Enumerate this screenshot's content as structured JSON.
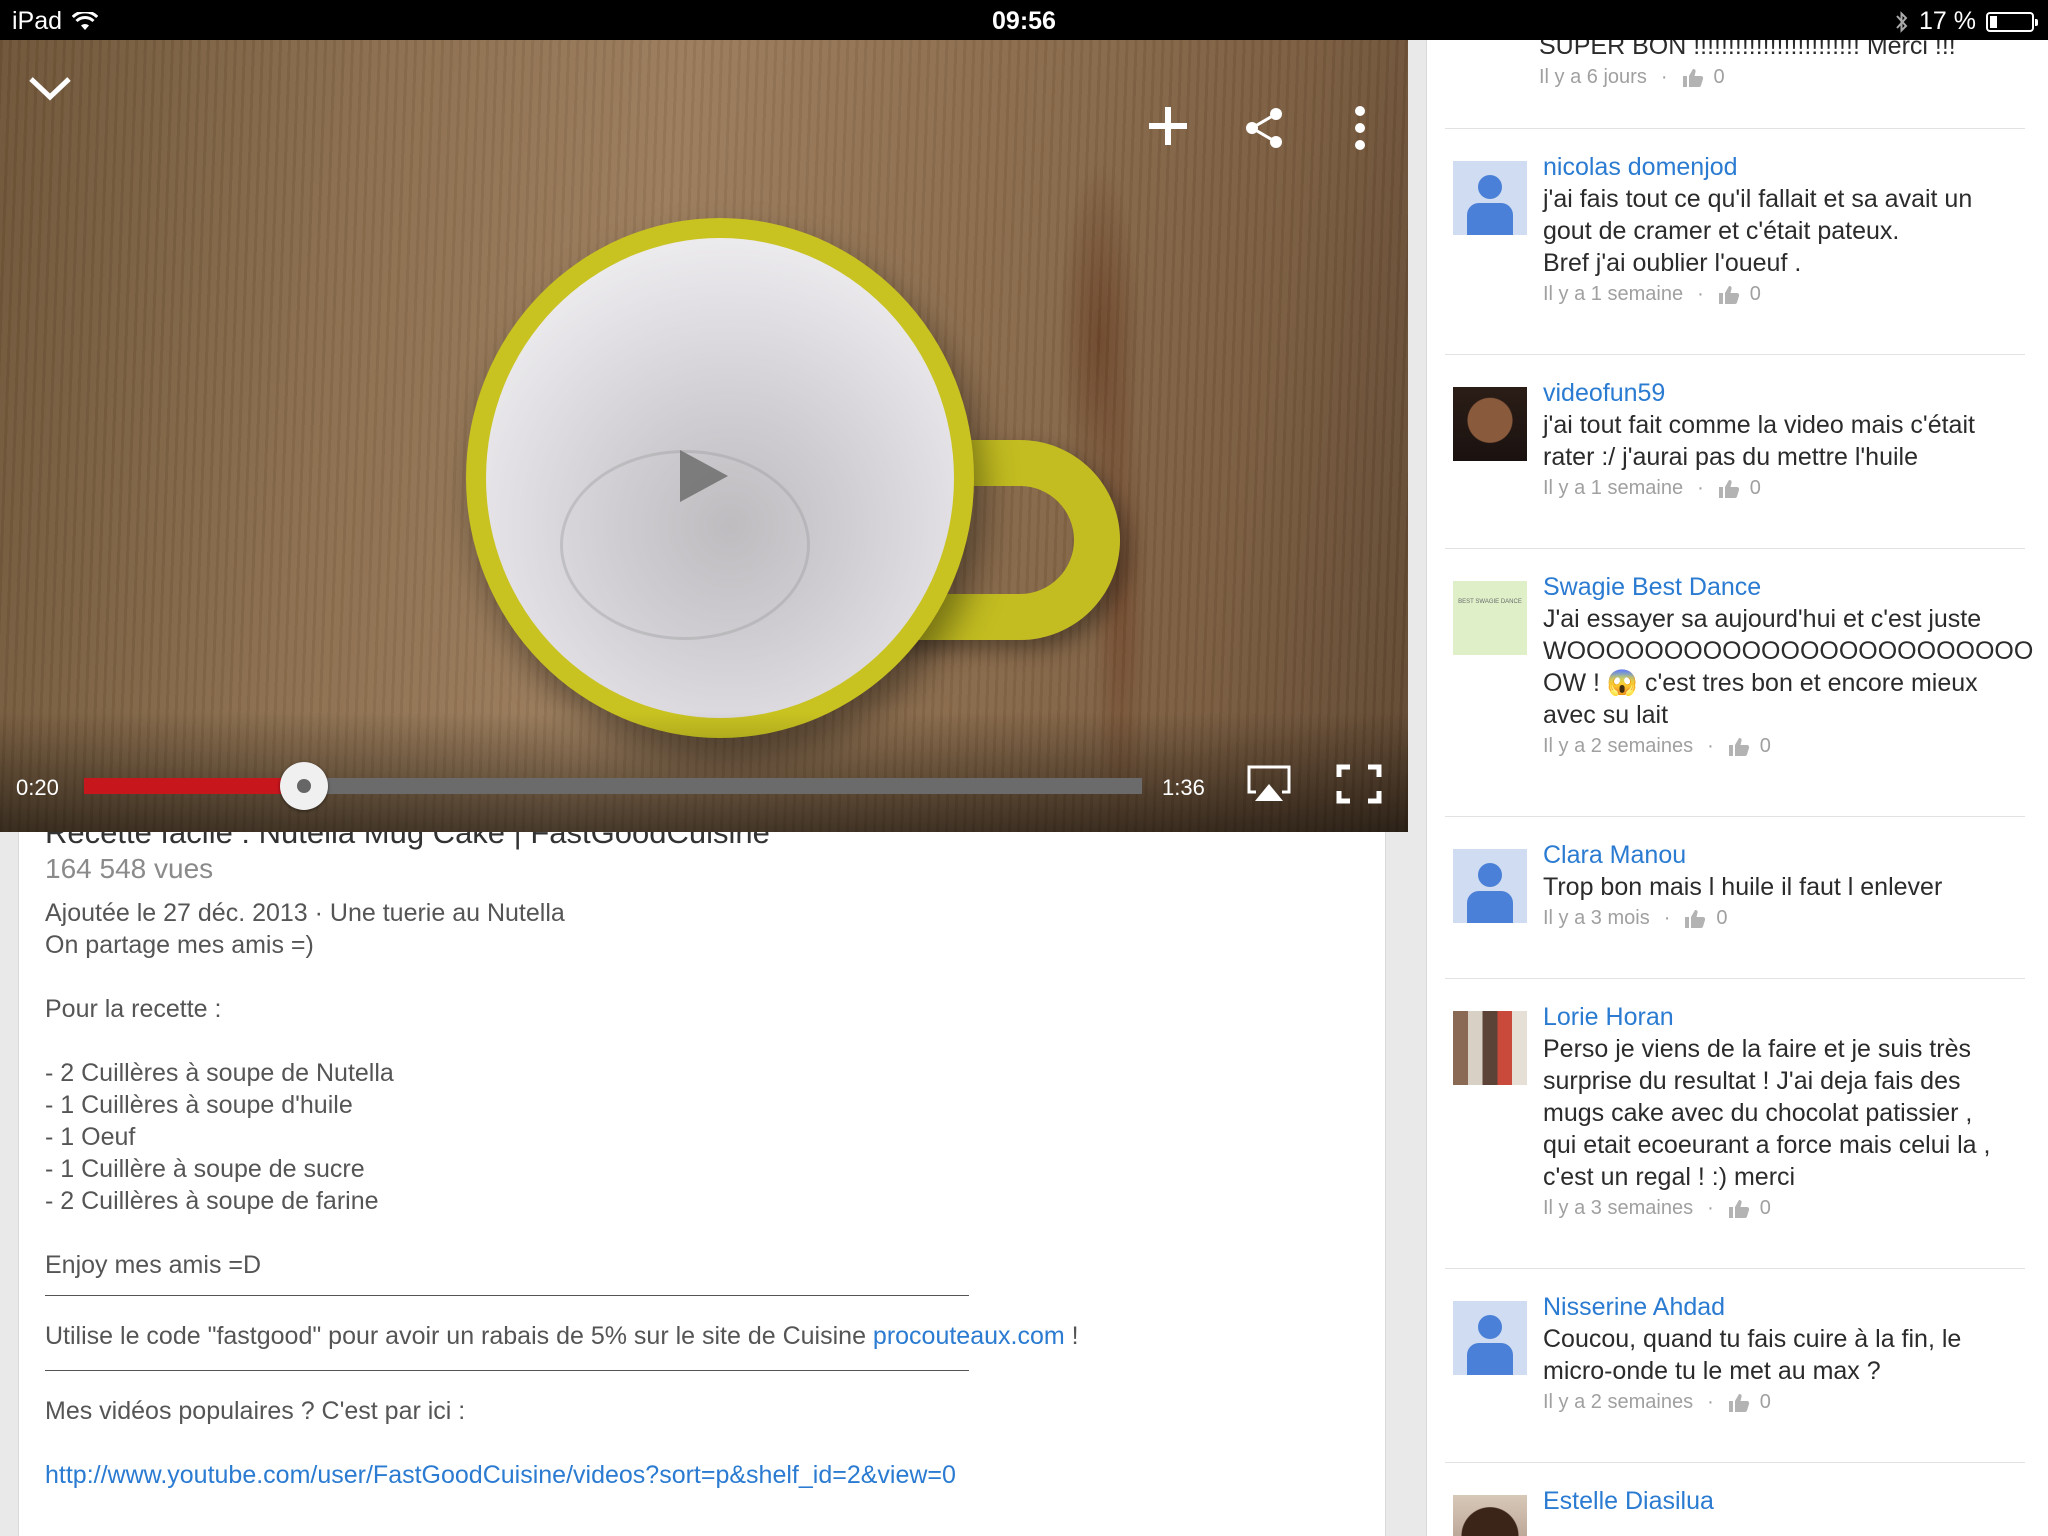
{
  "status_bar": {
    "device": "iPad",
    "time": "09:56",
    "battery_text": "17 %",
    "battery_level": 0.17
  },
  "video": {
    "current_time": "0:20",
    "duration": "1:36",
    "progress": 0.2083,
    "colors": {
      "played": "#c8161d",
      "track": "#6b6b6b"
    },
    "icons": {
      "collapse": "chevron-down-icon",
      "add": "plus-icon",
      "share": "share-icon",
      "more": "more-vertical-icon",
      "play": "play-icon",
      "airplay": "airplay-icon",
      "fullscreen": "fullscreen-icon"
    }
  },
  "details": {
    "title_partial": "Recette facile : Nutella Mug Cake | FastGoodCuisine",
    "views": "164 548 vues",
    "description_lines": [
      "Ajoutée le 27 déc. 2013 · Une tuerie au Nutella",
      "On partage mes amis =)",
      "",
      "Pour la recette :",
      "",
      "- 2 Cuillères à soupe de Nutella",
      "- 1 Cuillères à soupe d'huile",
      "- 1 Oeuf",
      "- 1 Cuillère à soupe de sucre",
      "- 2 Cuillères à soupe de farine",
      "",
      "Enjoy mes amis =D"
    ],
    "promo_text": "Utilise le code \"fastgood\" pour avoir un rabais de 5% sur le site de Cuisine ",
    "promo_link": "procouteaux.com",
    "promo_suffix": " !",
    "popular_text": "Mes vidéos populaires ? C'est par ici :",
    "popular_link": "http://www.youtube.com/user/FastGoodCuisine/videos?sort=p&shelf_id=2&view=0"
  },
  "comments": {
    "top_partial": {
      "text": "SUPER BON !!!!!!!!!!!!!!!!!!!!!!!! Merci !!!",
      "time": "Il y a 6 jours",
      "likes": "0"
    },
    "items": [
      {
        "author": "nicolas domenjod",
        "avatar": "default",
        "text": "j'ai fais tout ce qu'il fallait et sa avait un\ngout de cramer et c'était pateux.\nBref j'ai oublier l'oueuf .",
        "time": "Il y a 1 semaine",
        "likes": "0"
      },
      {
        "author": "videofun59",
        "avatar": "photo",
        "text": "j'ai tout fait comme la video mais c'était\nrater :/ j'aurai  pas du mettre l'huile",
        "time": "Il y a 1 semaine",
        "likes": "0"
      },
      {
        "author": "Swagie Best Dance",
        "avatar": "logo",
        "avatar_text": "BEST SWAGIE DANCE",
        "text": "J'ai essayer sa aujourd'hui et c'est juste\nWOOOOOOOOOOOOOOOOOOOOOOOO\nOW ! 😱 c'est tres bon et encore mieux\navec su lait",
        "time": "Il y a 2 semaines",
        "likes": "0"
      },
      {
        "author": "Clara Manou",
        "avatar": "default",
        "text": "Trop bon mais l huile il faut l enlever",
        "time": "Il y a 3 mois",
        "likes": "0"
      },
      {
        "author": "Lorie Horan",
        "avatar": "photo",
        "text": "Perso je viens de la faire et je suis très\nsurprise du resultat ! J'ai deja fais des\nmugs cake avec du chocolat patissier ,\nqui etait ecoeurant a force mais celui la ,\nc'est un regal ! :) merci",
        "time": "Il y a 3 semaines",
        "likes": "0"
      },
      {
        "author": "Nisserine Ahdad",
        "avatar": "default",
        "text": "Coucou, quand tu fais cuire à la fin, le\nmicro-onde tu le met au max ?",
        "time": "Il y a 2 semaines",
        "likes": "0"
      },
      {
        "author": "Estelle Diasilua",
        "avatar": "photo",
        "text": "",
        "time": "",
        "likes": ""
      }
    ]
  }
}
